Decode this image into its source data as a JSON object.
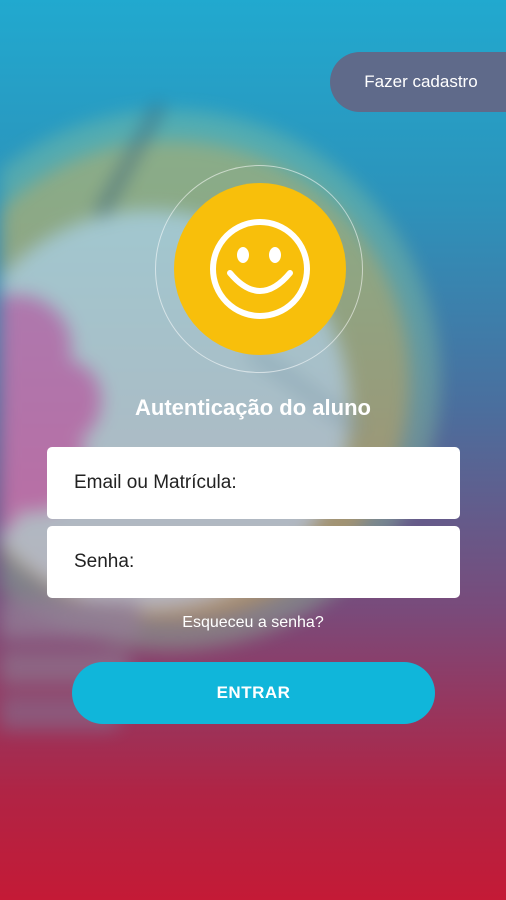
{
  "header": {
    "signup_label": "Fazer cadastro"
  },
  "logo": {
    "icon": "smiley-face-icon",
    "color": "#f8bf0b"
  },
  "login": {
    "title": "Autenticação do aluno",
    "email_placeholder": "Email ou Matrícula:",
    "email_value": "",
    "password_placeholder": "Senha:",
    "password_value": "",
    "forgot_label": "Esqueceu a senha?",
    "submit_label": "ENTRAR"
  },
  "colors": {
    "accent": "#10b6da",
    "signup_bg": "#5f6a8a",
    "gradient_top": "#21a9cf",
    "gradient_bottom": "#c41a36"
  }
}
